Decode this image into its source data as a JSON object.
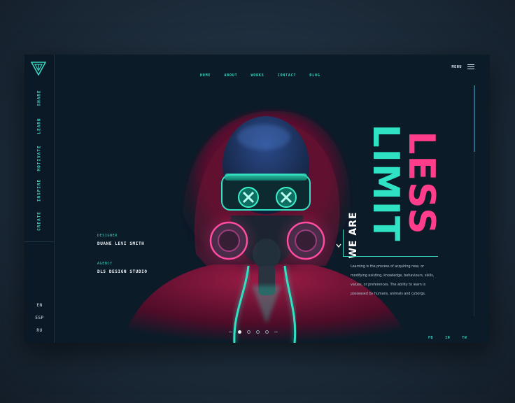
{
  "sidebar": {
    "items": [
      {
        "label": "SHARE"
      },
      {
        "label": "LEARN"
      },
      {
        "label": "MOTIVATE"
      },
      {
        "label": "INSPIRE"
      },
      {
        "label": "CREATE"
      }
    ],
    "languages": [
      {
        "label": "EN"
      },
      {
        "label": "ESP"
      },
      {
        "label": "RU"
      }
    ]
  },
  "nav": {
    "links": [
      {
        "label": "HOME"
      },
      {
        "label": "ABOUT"
      },
      {
        "label": "WORKS"
      },
      {
        "label": "CONTACT"
      },
      {
        "label": "BLOG"
      }
    ],
    "menu_label": "MENU"
  },
  "designer": {
    "label": "DESIGNER",
    "name": "DUANE LEVI SMITH"
  },
  "agency": {
    "label": "AGENCY",
    "name": "DLS DESIGN STUDIO"
  },
  "hero": {
    "eyebrow": "WE ARE",
    "word1": "LIMIT",
    "word2": "LESS",
    "description": "Learning is the process of acquiring new, or modifying existing, knowledge, behaviours, skills, values, or preferences. The ability to learn is possessed by humans, animals and cyborgs."
  },
  "socials": [
    {
      "label": "FB"
    },
    {
      "label": "IN"
    },
    {
      "label": "TW"
    },
    {
      "label": "YT"
    }
  ],
  "pager": {
    "count": 5,
    "active": 1
  },
  "colors": {
    "accent_teal": "#2fe2c3",
    "accent_pink": "#ff3d8b",
    "background": "#0c1b28"
  }
}
